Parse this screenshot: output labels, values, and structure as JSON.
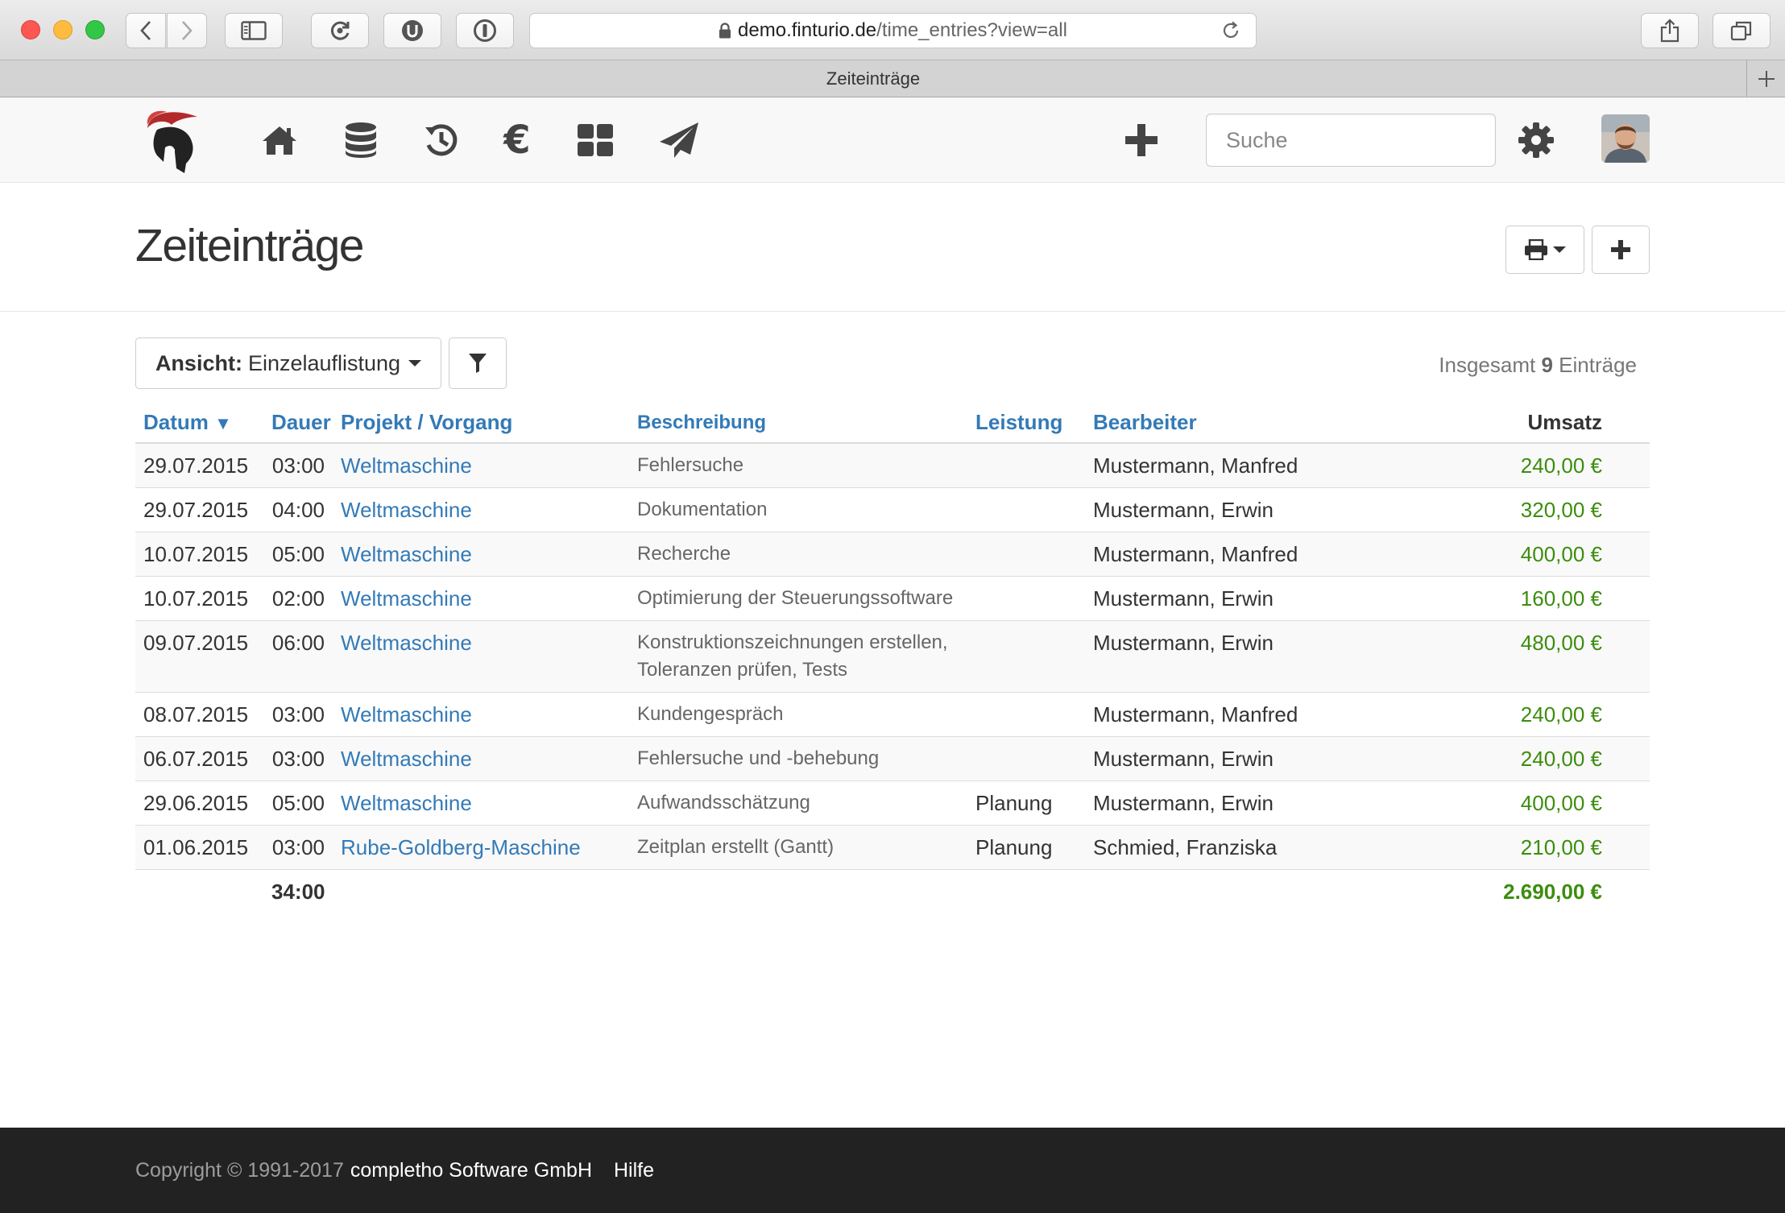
{
  "browser": {
    "url_host": "demo.finturio.de",
    "url_path": "/time_entries?view=all",
    "tab_title": "Zeiteinträge",
    "colors": {
      "close": "#fc5753",
      "minimize": "#fdbc40",
      "zoom": "#33c748"
    }
  },
  "navbar": {
    "icons": [
      "logo-spartan-helmet",
      "home-icon",
      "database-icon",
      "history-icon",
      "euro-icon",
      "grid-icon",
      "paper-plane-icon",
      "plus-icon",
      "gear-icon"
    ],
    "search_placeholder": "Suche"
  },
  "page": {
    "title": "Zeiteinträge",
    "view_label": "Ansicht:",
    "view_value": "Einzelauflistung",
    "total_prefix": "Insgesamt",
    "total_count": "9",
    "total_suffix": "Einträge"
  },
  "table": {
    "columns": {
      "date": "Datum",
      "duration": "Dauer",
      "project": "Projekt / Vorgang",
      "description": "Beschreibung",
      "service": "Leistung",
      "employee": "Bearbeiter",
      "revenue": "Umsatz"
    },
    "sort_indicator": "▼",
    "rows": [
      {
        "date": "29.07.2015",
        "duration": "03:00",
        "project": "Weltmaschine",
        "description": "Fehlersuche",
        "service": "",
        "employee": "Mustermann, Manfred",
        "revenue": "240,00 €"
      },
      {
        "date": "29.07.2015",
        "duration": "04:00",
        "project": "Weltmaschine",
        "description": "Dokumentation",
        "service": "",
        "employee": "Mustermann, Erwin",
        "revenue": "320,00 €"
      },
      {
        "date": "10.07.2015",
        "duration": "05:00",
        "project": "Weltmaschine",
        "description": "Recherche",
        "service": "",
        "employee": "Mustermann, Manfred",
        "revenue": "400,00 €"
      },
      {
        "date": "10.07.2015",
        "duration": "02:00",
        "project": "Weltmaschine",
        "description": "Optimierung der Steuerungssoftware",
        "service": "",
        "employee": "Mustermann, Erwin",
        "revenue": "160,00 €"
      },
      {
        "date": "09.07.2015",
        "duration": "06:00",
        "project": "Weltmaschine",
        "description": "Konstruktionszeichnungen erstellen, Toleranzen prüfen, Tests",
        "service": "",
        "employee": "Mustermann, Erwin",
        "revenue": "480,00 €"
      },
      {
        "date": "08.07.2015",
        "duration": "03:00",
        "project": "Weltmaschine",
        "description": "Kundengespräch",
        "service": "",
        "employee": "Mustermann, Manfred",
        "revenue": "240,00 €"
      },
      {
        "date": "06.07.2015",
        "duration": "03:00",
        "project": "Weltmaschine",
        "description": "Fehlersuche und -behebung",
        "service": "",
        "employee": "Mustermann, Erwin",
        "revenue": "240,00 €"
      },
      {
        "date": "29.06.2015",
        "duration": "05:00",
        "project": "Weltmaschine",
        "description": "Aufwandsschätzung",
        "service": "Planung",
        "employee": "Mustermann, Erwin",
        "revenue": "400,00 €"
      },
      {
        "date": "01.06.2015",
        "duration": "03:00",
        "project": "Rube-Goldberg-Maschine",
        "description": "Zeitplan erstellt (Gantt)",
        "service": "Planung",
        "employee": "Schmied, Franziska",
        "revenue": "210,00 €"
      }
    ],
    "total_duration": "34:00",
    "total_revenue": "2.690,00 €"
  },
  "footer": {
    "copyright": "Copyright © 1991-2017",
    "company": "completho Software GmbH",
    "help": "Hilfe"
  },
  "theme": {
    "link": "#337ab7",
    "revenue_green": "#3c8d0d",
    "footer_bg": "#222222",
    "logo_red": "#b42a2a"
  }
}
